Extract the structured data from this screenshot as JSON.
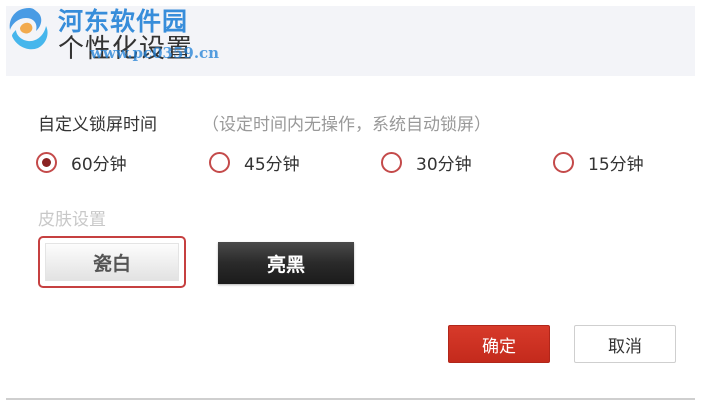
{
  "watermark": {
    "name": "河东软件园",
    "url": "www.pc0359.cn",
    "logo_icon": "blue-swirl-logo"
  },
  "header": {
    "title": "个性化设置"
  },
  "lock_time": {
    "label": "自定义锁屏时间",
    "hint": "（设定时间内无操作，系统自动锁屏）",
    "selected": "60分钟",
    "options": [
      {
        "label": "60分钟",
        "checked": true
      },
      {
        "label": "45分钟",
        "checked": false
      },
      {
        "label": "30分钟",
        "checked": false
      },
      {
        "label": "15分钟",
        "checked": false
      }
    ]
  },
  "skin": {
    "label": "皮肤设置",
    "selected": "瓷白",
    "options": [
      {
        "label": "瓷白"
      },
      {
        "label": "亮黑"
      }
    ]
  },
  "actions": {
    "confirm_label": "确定",
    "cancel_label": "取消"
  },
  "colors": {
    "accent_red": "#c42a1c",
    "radio_border": "#c44a4a",
    "watermark_blue": "#1e7fd6",
    "header_bg": "#f3f4f8"
  }
}
